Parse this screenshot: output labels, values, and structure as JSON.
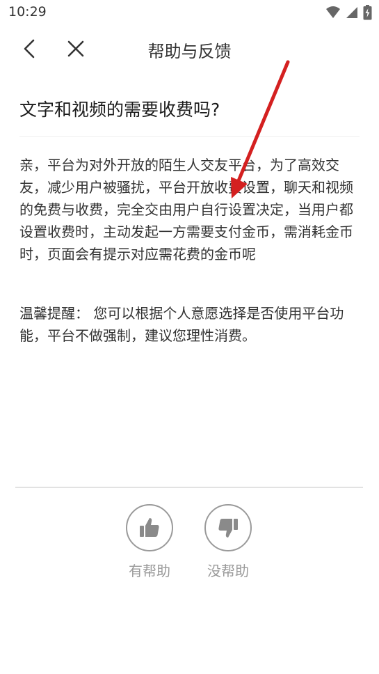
{
  "status_bar": {
    "time": "10:29",
    "icons": [
      "wifi-icon",
      "signal-icon",
      "battery-icon"
    ]
  },
  "nav": {
    "title": "帮助与反馈",
    "back_icon": "chevron-left-icon",
    "close_icon": "close-icon"
  },
  "article": {
    "title": "文字和视频的需要收费吗?",
    "body": "亲，平台为对外开放的陌生人交友平台，为了高效交友，减少用户被骚扰，平台开放收费设置，聊天和视频的免费与收费，完全交由用户自行设置决定，当用户都设置收费时，主动发起一方需要支付金币，需消耗金币时，页面会有提示对应需花费的金币呢",
    "tip": "温馨提醒：  您可以根据个人意愿选择是否使用平台功能，平台不做强制，建议您理性消费。"
  },
  "feedback": {
    "helpful_label": "有帮助",
    "not_helpful_label": "没帮助",
    "helpful_icon": "thumbs-up-icon",
    "not_helpful_icon": "thumbs-down-icon"
  },
  "colors": {
    "annotation_arrow": "#d42020",
    "icon_gray": "#8a8a8a",
    "divider": "#e2e2e2"
  }
}
